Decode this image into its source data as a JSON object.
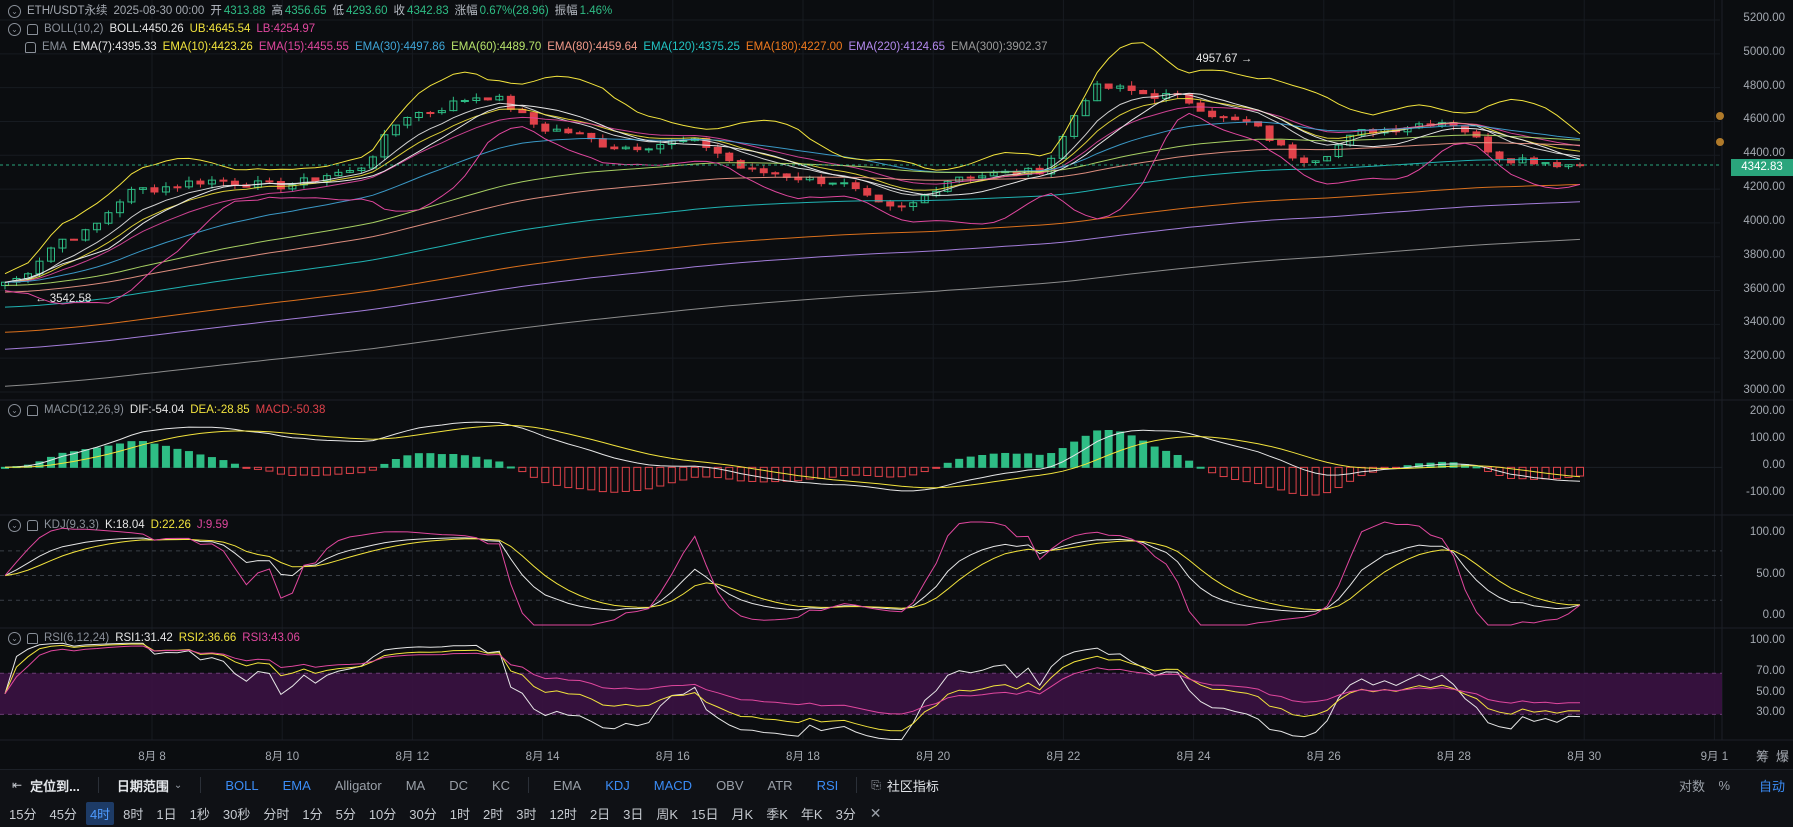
{
  "legend_main": {
    "symbol": "ETH/USDT永续",
    "date": "2025-08-30 00:00",
    "open_label": "开",
    "open": "4313.88",
    "high_label": "高",
    "high": "4356.65",
    "low_label": "低",
    "low": "4293.60",
    "close_label": "收",
    "close": "4342.83",
    "change_label": "涨幅",
    "change": "0.67%(28.96)",
    "amp_label": "振幅",
    "amp": "1.46%"
  },
  "legend_boll": {
    "name": "BOLL(10,2)",
    "boll": "BOLL:4450.26",
    "ub": "UB:4645.54",
    "lb": "LB:4254.97"
  },
  "legend_ema": {
    "name": "EMA",
    "items": [
      {
        "text": "EMA(7):4395.33",
        "color": "#e6e6e6"
      },
      {
        "text": "EMA(10):4423.26",
        "color": "#f2e33d"
      },
      {
        "text": "EMA(15):4455.55",
        "color": "#e0479e"
      },
      {
        "text": "EMA(30):4497.86",
        "color": "#3fa6d8"
      },
      {
        "text": "EMA(60):4489.70",
        "color": "#b7e36b"
      },
      {
        "text": "EMA(80):4459.64",
        "color": "#f29a8a"
      },
      {
        "text": "EMA(120):4375.25",
        "color": "#22c4c4"
      },
      {
        "text": "EMA(180):4227.00",
        "color": "#f07a1e"
      },
      {
        "text": "EMA(220):4124.65",
        "color": "#b48af0"
      },
      {
        "text": "EMA(300):3902.37",
        "color": "#9a9a9a"
      }
    ]
  },
  "legend_macd": {
    "name": "MACD(12,26,9)",
    "dif": "DIF:-54.04",
    "dea": "DEA:-28.85",
    "macd": "MACD:-50.38"
  },
  "legend_kdj": {
    "name": "KDJ(9,3,3)",
    "k": "K:18.04",
    "d": "D:22.26",
    "j": "J:9.59"
  },
  "legend_rsi": {
    "name": "RSI(6,12,24)",
    "r1": "RSI1:31.42",
    "r2": "RSI2:36.66",
    "r3": "RSI3:43.06"
  },
  "price_axis": [
    "5200.00",
    "5000.00",
    "4800.00",
    "4600.00",
    "4400.00",
    "4200.00",
    "4000.00",
    "3800.00",
    "3600.00",
    "3400.00",
    "3200.00",
    "3000.00"
  ],
  "macd_axis": [
    "200.00",
    "100.00",
    "0.00",
    "-100.00"
  ],
  "kdj_axis": [
    "100.00",
    "50.00",
    "0.00"
  ],
  "rsi_axis": [
    "100.00",
    "70.00",
    "50.00",
    "30.00"
  ],
  "date_axis": [
    "8月 8",
    "8月 10",
    "8月 12",
    "8月 14",
    "8月 16",
    "8月 18",
    "8月 20",
    "8月 22",
    "8月 24",
    "8月 26",
    "8月 28",
    "8月 30",
    "9月 1"
  ],
  "current_price": "4342.83",
  "max_mark": "4957.67 →",
  "min_mark": "← 3542.58",
  "colors": {
    "up": "#2ebd85",
    "down": "#e0424a",
    "accent": "#3b8cf5",
    "rsi_band": "#3a1242"
  },
  "toolbar": {
    "locate": "定位到...",
    "range": "日期范围",
    "main_indicators": [
      "BOLL",
      "EMA",
      "Alligator",
      "MA",
      "DC",
      "KC"
    ],
    "main_active": [
      "BOLL",
      "EMA"
    ],
    "sub_indicators": [
      "EMA",
      "KDJ",
      "MACD",
      "OBV",
      "ATR",
      "RSI"
    ],
    "sub_active": [
      "KDJ",
      "MACD",
      "RSI"
    ],
    "community": "社区指标",
    "log": "对数",
    "percent": "%",
    "auto": "自动",
    "right_top": [
      "筹",
      "爆"
    ]
  },
  "intervals": [
    "15分",
    "45分",
    "4时",
    "8时",
    "1日",
    "1秒",
    "30秒",
    "分时",
    "1分",
    "5分",
    "10分",
    "30分",
    "1时",
    "2时",
    "3时",
    "12时",
    "2日",
    "3日",
    "周K",
    "15日",
    "月K",
    "季K",
    "年K",
    "3分"
  ],
  "active_interval": "4时",
  "close_icon": "close-icon",
  "chart_data": {
    "type": "candlestick",
    "timeframe": "4时",
    "price_range": [
      3000,
      5200
    ],
    "highest": 4957.67,
    "lowest": 3542.58,
    "last_close": 4342.83,
    "anchors": [
      {
        "date": "8月 7",
        "close": 3650
      },
      {
        "date": "8月 8",
        "close": 3920
      },
      {
        "date": "8月 9",
        "close": 4200
      },
      {
        "date": "8月 10",
        "close": 4250
      },
      {
        "date": "8月 11",
        "close": 4220
      },
      {
        "date": "8月 12",
        "close": 4300
      },
      {
        "date": "8月 13",
        "close": 4650
      },
      {
        "date": "8月 14",
        "close": 4750
      },
      {
        "date": "8月 15",
        "close": 4550
      },
      {
        "date": "8月 16",
        "close": 4450
      },
      {
        "date": "8月 17",
        "close": 4480
      },
      {
        "date": "8月 18",
        "close": 4300
      },
      {
        "date": "8月 19",
        "close": 4250
      },
      {
        "date": "8月 20",
        "close": 4080
      },
      {
        "date": "8月 21",
        "close": 4280
      },
      {
        "date": "8月 22",
        "close": 4300
      },
      {
        "date": "8月 23",
        "close": 4800
      },
      {
        "date": "8月 24",
        "close": 4750
      },
      {
        "date": "8月 25",
        "close": 4600
      },
      {
        "date": "8月 26",
        "close": 4380
      },
      {
        "date": "8月 27",
        "close": 4550
      },
      {
        "date": "8月 28",
        "close": 4600
      },
      {
        "date": "8月 29",
        "close": 4380
      },
      {
        "date": "8月 30",
        "close": 4342.83
      }
    ],
    "ema": {
      "7": 4395.33,
      "10": 4423.26,
      "15": 4455.55,
      "30": 4497.86,
      "60": 4489.7,
      "80": 4459.64,
      "120": 4375.25,
      "180": 4227.0,
      "220": 4124.65,
      "300": 3902.37
    },
    "boll": {
      "mid": 4450.26,
      "upper": 4645.54,
      "lower": 4254.97
    },
    "macd": {
      "dif": -54.04,
      "dea": -28.85,
      "hist": -50.38,
      "range": [
        -150,
        230
      ]
    },
    "kdj": {
      "k": 18.04,
      "d": 22.26,
      "j": 9.59,
      "range": [
        -10,
        115
      ],
      "levels": [
        20,
        50,
        80
      ]
    },
    "rsi": {
      "rsi6": 31.42,
      "rsi12": 36.66,
      "rsi24": 43.06,
      "range": [
        10,
        110
      ],
      "band": [
        30,
        70
      ]
    }
  }
}
